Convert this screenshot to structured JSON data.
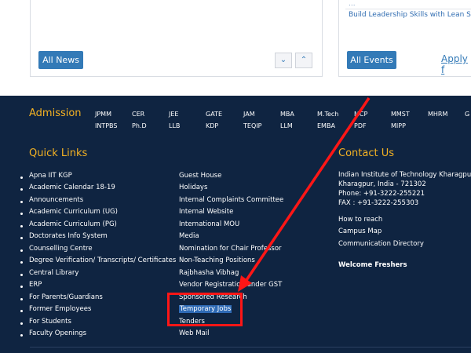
{
  "news": {
    "all_news_label": "All News"
  },
  "events": {
    "item_partial_1": "...",
    "item_partial_2": "Build Leadership Skills with Lean Six S",
    "all_events_label": "All Events",
    "apply_label": "Apply f"
  },
  "admission": {
    "heading": "Admission",
    "codes_row1": [
      "JPMM",
      "CER",
      "JEE",
      "GATE",
      "JAM",
      "MBA",
      "M.Tech",
      "MCP",
      "MMST",
      "MHRM",
      "G"
    ],
    "codes_row2": [
      "INTPBS",
      "Ph.D",
      "LLB",
      "KDP",
      "TEQIP",
      "LLM",
      "EMBA",
      "PDF",
      "MIPP"
    ]
  },
  "quick_links": {
    "heading": "Quick Links",
    "col1": [
      "Apna IIT KGP",
      "Academic Calendar 18-19",
      "Announcements",
      "Academic Curriculum (UG)",
      "Academic Curriculum (PG)",
      "Doctorates Info System",
      "Counselling Centre",
      "Degree Verification/ Transcripts/ Certificates",
      "Central Library",
      "ERP",
      "For Parents/Guardians",
      "Former Employees",
      "For Students",
      "Faculty Openings"
    ],
    "col2": [
      "Guest House",
      "Holidays",
      "Internal Complaints Committee",
      "Internal Website",
      "International MOU",
      "Media",
      "Nomination for Chair Professor",
      "Non-Teaching Positions",
      "Rajbhasha Vibhag",
      "Vendor Registration under GST",
      "Sponsored Research",
      "Temporary Jobs",
      "Tenders",
      "Web Mail"
    ]
  },
  "contact": {
    "heading": "Contact Us",
    "address": [
      "Indian Institute of Technology Kharagpur",
      "Kharagpur, India - 721302",
      "Phone: +91-3222-255221",
      "FAX : +91-3222-255303"
    ],
    "links": [
      "How to reach",
      "Campus Map",
      "Communication Directory"
    ],
    "welcome": "Welcome Freshers"
  },
  "annotation": {
    "color": "#ff1616"
  }
}
